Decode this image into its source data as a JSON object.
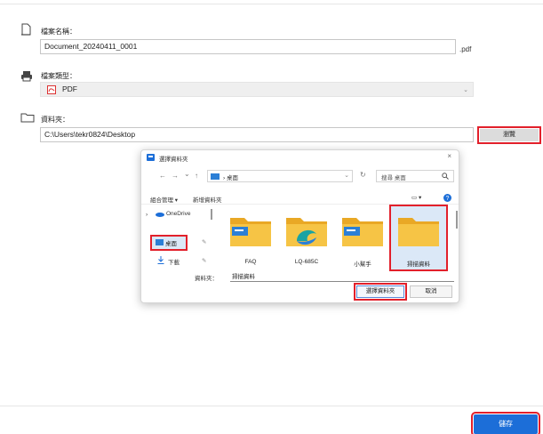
{
  "form": {
    "filename_label": "檔案名稱：",
    "filename_value": "Document_20240411_0001",
    "filename_ext": ".pdf",
    "filetype_label": "檔案類型：",
    "filetype_value": "PDF",
    "folder_label": "資料夾：",
    "folder_value": "C:\\Users\\tekr0824\\Desktop",
    "browse_label": "瀏覽",
    "save_label": "儲存"
  },
  "dialog": {
    "title": "選擇資料夾",
    "close": "×",
    "nav_back": "←",
    "nav_forward": "→",
    "nav_down": "⌄",
    "nav_up": "↑",
    "address": "› 桌面",
    "refresh": "↻",
    "search_placeholder": "搜尋 桌面",
    "toolbar_organize": "組合管理 ▾",
    "toolbar_new_folder": "新增資料夾",
    "view_icon": "▭ ▾",
    "nav_onedrive": "OneDrive",
    "nav_desktop": "桌面",
    "nav_downloads": "下載",
    "folders": [
      {
        "label": "FAQ"
      },
      {
        "label": "LQ-685C"
      },
      {
        "label": "小幫手"
      },
      {
        "label": "掃描資料"
      }
    ],
    "folder_field_label": "資料夾：",
    "folder_field_value": "掃描資料",
    "select_label": "選擇資料夾",
    "cancel_label": "取消"
  },
  "colors": {
    "accent": "#1c6ed8",
    "highlight": "#e2202b",
    "folder": "#f6c445"
  }
}
